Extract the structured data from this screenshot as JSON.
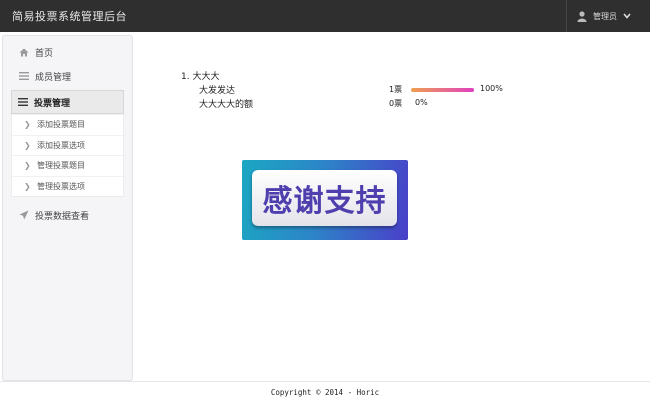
{
  "app": {
    "title": "简易投票系统管理后台"
  },
  "user": {
    "name": "管理员",
    "avatar_icon": "user-icon",
    "caret_icon": "chevron-down-icon"
  },
  "sidebar": {
    "items": [
      {
        "label": "首页",
        "icon": "home-icon"
      },
      {
        "label": "成员管理",
        "icon": "list-icon"
      },
      {
        "label": "投票管理",
        "icon": "list-icon",
        "active": true
      },
      {
        "label": "投票数据查看",
        "icon": "send-icon"
      }
    ],
    "submenu": [
      {
        "label": "添加投票题目"
      },
      {
        "label": "添加投票选项"
      },
      {
        "label": "管理投票题目"
      },
      {
        "label": "管理投票选项"
      }
    ]
  },
  "poll": {
    "question": "1. 大大大",
    "options": [
      {
        "label": "大发发达",
        "votes": "1票",
        "percent_text": "100%",
        "percent": 100
      },
      {
        "label": "大大大大的额",
        "votes": "0票",
        "percent_text": "0%",
        "percent": 0
      }
    ]
  },
  "banner": {
    "text": "感谢支持"
  },
  "footer": {
    "text": "Copyright © 2014 - Horic"
  },
  "colors": {
    "topbar": "#2f2f2f",
    "bar_start": "#f0a050",
    "bar_end": "#e040c0",
    "banner_text": "#4f3fae"
  }
}
